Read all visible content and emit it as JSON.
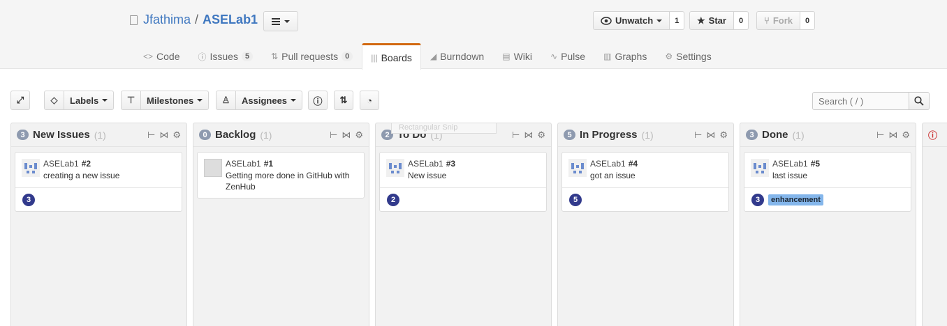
{
  "repo": {
    "owner": "Jfathima",
    "separator": "/",
    "name": "ASELab1"
  },
  "actions": {
    "unwatch": {
      "label": "Unwatch",
      "count": "1"
    },
    "star": {
      "label": "Star",
      "count": "0"
    },
    "fork": {
      "label": "Fork",
      "count": "0"
    }
  },
  "nav": [
    {
      "label": "Code",
      "icon": "code-icon",
      "counter": ""
    },
    {
      "label": "Issues",
      "icon": "issue-icon",
      "counter": "5"
    },
    {
      "label": "Pull requests",
      "icon": "pull-request-icon",
      "counter": "0"
    },
    {
      "label": "Boards",
      "icon": "boards-icon",
      "counter": "",
      "selected": true
    },
    {
      "label": "Burndown",
      "icon": "burndown-icon",
      "counter": ""
    },
    {
      "label": "Wiki",
      "icon": "wiki-icon",
      "counter": ""
    },
    {
      "label": "Pulse",
      "icon": "pulse-icon",
      "counter": ""
    },
    {
      "label": "Graphs",
      "icon": "graph-icon",
      "counter": ""
    },
    {
      "label": "Settings",
      "icon": "gear-icon",
      "counter": ""
    }
  ],
  "toolbar": {
    "labels": "Labels",
    "milestones": "Milestones",
    "assignees": "Assignees",
    "search_placeholder": "Search ( / )"
  },
  "snip_label": "Rectangular Snip",
  "pipelines": [
    {
      "name": "New Issues",
      "count": "3",
      "issues": "(1)",
      "card": {
        "repo": "ASELab1",
        "num": "#2",
        "title": "creating a new issue",
        "estimate": "3",
        "label": "",
        "avatar": "identicon"
      }
    },
    {
      "name": "Backlog",
      "count": "0",
      "issues": "(1)",
      "card": {
        "repo": "ASELab1",
        "num": "#1",
        "title": "Getting more done in GitHub with ZenHub",
        "estimate": "",
        "label": "",
        "avatar": "gray"
      }
    },
    {
      "name": "To Do",
      "count": "2",
      "issues": "(1)",
      "card": {
        "repo": "ASELab1",
        "num": "#3",
        "title": "New issue",
        "estimate": "2",
        "label": "",
        "avatar": "identicon"
      }
    },
    {
      "name": "In Progress",
      "count": "5",
      "issues": "(1)",
      "card": {
        "repo": "ASELab1",
        "num": "#4",
        "title": "got an issue",
        "estimate": "5",
        "label": "",
        "avatar": "identicon"
      }
    },
    {
      "name": "Done",
      "count": "3",
      "issues": "(1)",
      "card": {
        "repo": "ASELab1",
        "num": "#5",
        "title": "last issue",
        "estimate": "3",
        "label": "enhancement",
        "avatar": "identicon"
      }
    }
  ],
  "colors": {
    "accent_tab": "#d26911",
    "estimate": "#323a8c",
    "label_enhancement": "#84b6eb",
    "link": "#4078c0"
  }
}
